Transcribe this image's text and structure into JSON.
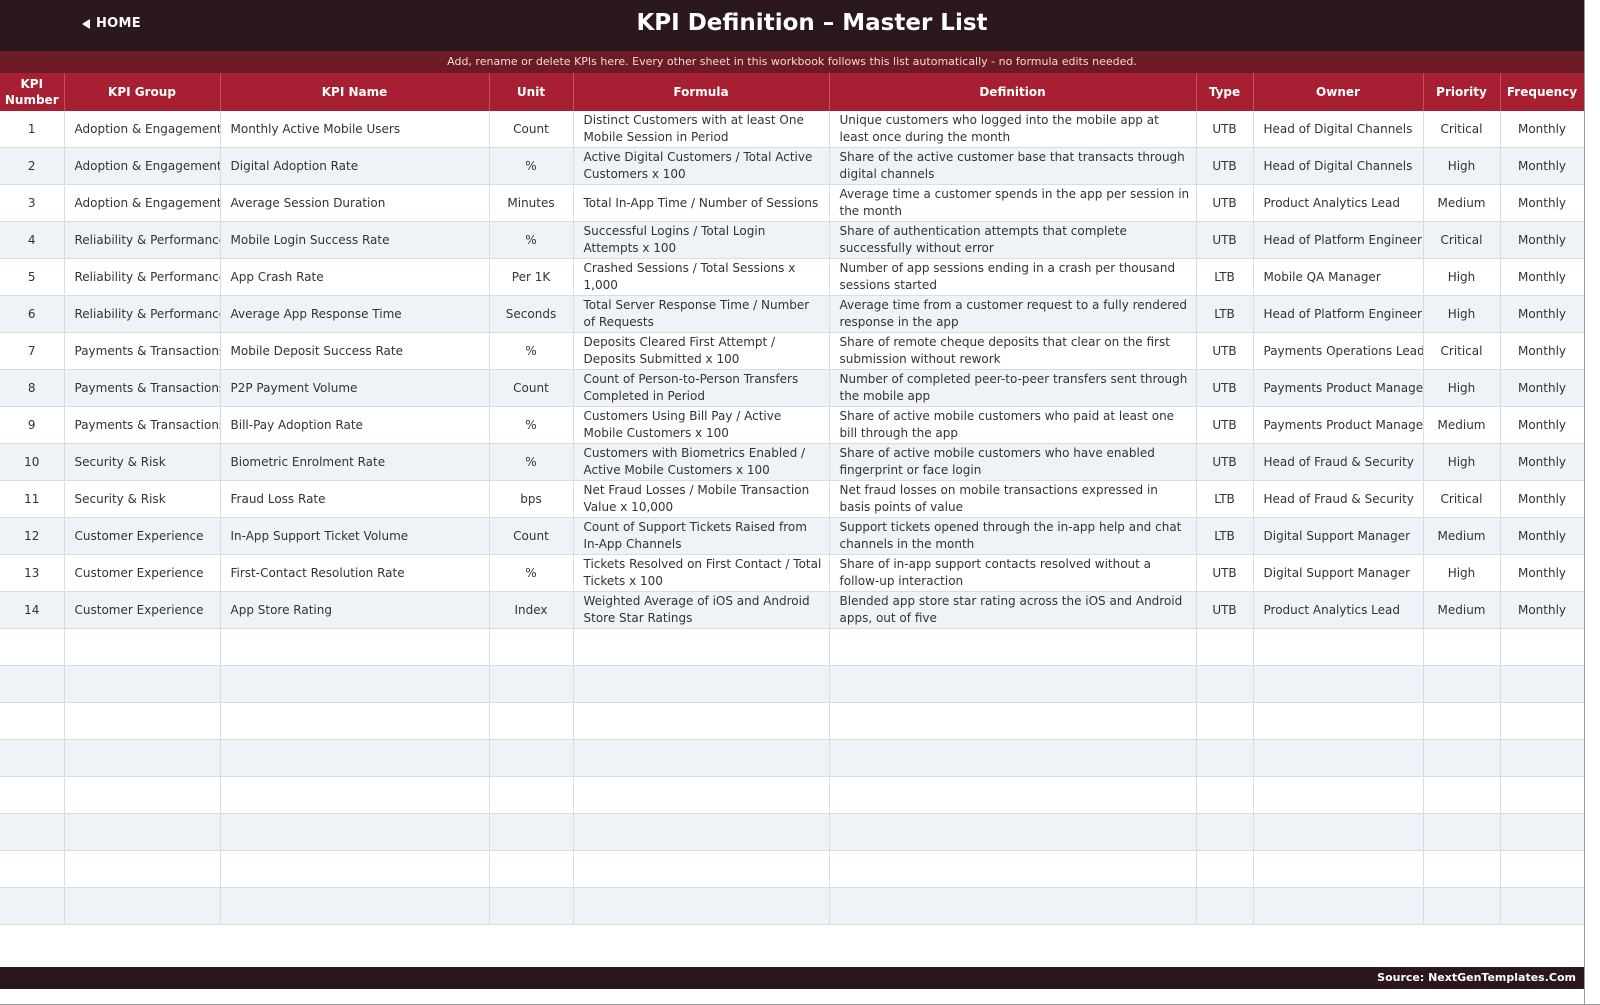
{
  "header": {
    "home_label": "HOME",
    "title": "KPI Definition  –  Master List",
    "subtitle": "Add, rename or delete KPIs here. Every other sheet in this workbook follows this list automatically - no formula edits needed."
  },
  "columns": [
    "KPI Number",
    "KPI Group",
    "KPI Name",
    "Unit",
    "Formula",
    "Definition",
    "Type",
    "Owner",
    "Priority",
    "Frequency"
  ],
  "rows": [
    [
      "1",
      "Adoption & Engagement",
      "Monthly Active Mobile Users",
      "Count",
      "Distinct Customers with at least One Mobile Session in Period",
      "Unique customers who logged into the mobile app at least once during the month",
      "UTB",
      "Head of Digital Channels",
      "Critical",
      "Monthly"
    ],
    [
      "2",
      "Adoption & Engagement",
      "Digital Adoption Rate",
      "%",
      "Active Digital Customers / Total Active Customers x 100",
      "Share of the active customer base that transacts through digital channels",
      "UTB",
      "Head of Digital Channels",
      "High",
      "Monthly"
    ],
    [
      "3",
      "Adoption & Engagement",
      "Average Session Duration",
      "Minutes",
      "Total In-App Time / Number of Sessions",
      "Average time a customer spends in the app per session in the month",
      "UTB",
      "Product Analytics Lead",
      "Medium",
      "Monthly"
    ],
    [
      "4",
      "Reliability & Performance",
      "Mobile Login Success Rate",
      "%",
      "Successful Logins / Total Login Attempts x 100",
      "Share of authentication attempts that complete successfully without error",
      "UTB",
      "Head of Platform Engineering",
      "Critical",
      "Monthly"
    ],
    [
      "5",
      "Reliability & Performance",
      "App Crash Rate",
      "Per 1K",
      "Crashed Sessions / Total Sessions x 1,000",
      "Number of app sessions ending in a crash per thousand sessions started",
      "LTB",
      "Mobile QA Manager",
      "High",
      "Monthly"
    ],
    [
      "6",
      "Reliability & Performance",
      "Average App Response Time",
      "Seconds",
      "Total Server Response Time / Number of Requests",
      "Average time from a customer request to a fully rendered response in the app",
      "LTB",
      "Head of Platform Engineering",
      "High",
      "Monthly"
    ],
    [
      "7",
      "Payments & Transactions",
      "Mobile Deposit Success Rate",
      "%",
      "Deposits Cleared First Attempt / Deposits Submitted x 100",
      "Share of remote cheque deposits that clear on the first submission without rework",
      "UTB",
      "Payments Operations Lead",
      "Critical",
      "Monthly"
    ],
    [
      "8",
      "Payments & Transactions",
      "P2P Payment Volume",
      "Count",
      "Count of Person-to-Person Transfers Completed in Period",
      "Number of completed peer-to-peer transfers sent through the mobile app",
      "UTB",
      "Payments Product Manager",
      "High",
      "Monthly"
    ],
    [
      "9",
      "Payments & Transactions",
      "Bill-Pay Adoption Rate",
      "%",
      "Customers Using Bill Pay / Active Mobile Customers x 100",
      "Share of active mobile customers who paid at least one bill through the app",
      "UTB",
      "Payments Product Manager",
      "Medium",
      "Monthly"
    ],
    [
      "10",
      "Security & Risk",
      "Biometric Enrolment Rate",
      "%",
      "Customers with Biometrics Enabled / Active Mobile Customers x 100",
      "Share of active mobile customers who have enabled fingerprint or face login",
      "UTB",
      "Head of Fraud & Security",
      "High",
      "Monthly"
    ],
    [
      "11",
      "Security & Risk",
      "Fraud Loss Rate",
      "bps",
      "Net Fraud Losses / Mobile Transaction Value x 10,000",
      "Net fraud losses on mobile transactions expressed in basis points of value",
      "LTB",
      "Head of Fraud & Security",
      "Critical",
      "Monthly"
    ],
    [
      "12",
      "Customer Experience",
      "In-App Support Ticket Volume",
      "Count",
      "Count of Support Tickets Raised from In-App Channels",
      "Support tickets opened through the in-app help and chat channels in the month",
      "LTB",
      "Digital Support Manager",
      "Medium",
      "Monthly"
    ],
    [
      "13",
      "Customer Experience",
      "First-Contact Resolution Rate",
      "%",
      "Tickets Resolved on First Contact / Total Tickets x 100",
      "Share of in-app support contacts resolved without a follow-up interaction",
      "UTB",
      "Digital Support Manager",
      "High",
      "Monthly"
    ],
    [
      "14",
      "Customer Experience",
      "App Store Rating",
      "Index",
      "Weighted Average of iOS and Android Store Star Ratings",
      "Blended app store star rating across the iOS and Android apps, out of five",
      "UTB",
      "Product Analytics Lead",
      "Medium",
      "Monthly"
    ]
  ],
  "footer": {
    "source": "Source: NextGenTemplates.Com"
  }
}
